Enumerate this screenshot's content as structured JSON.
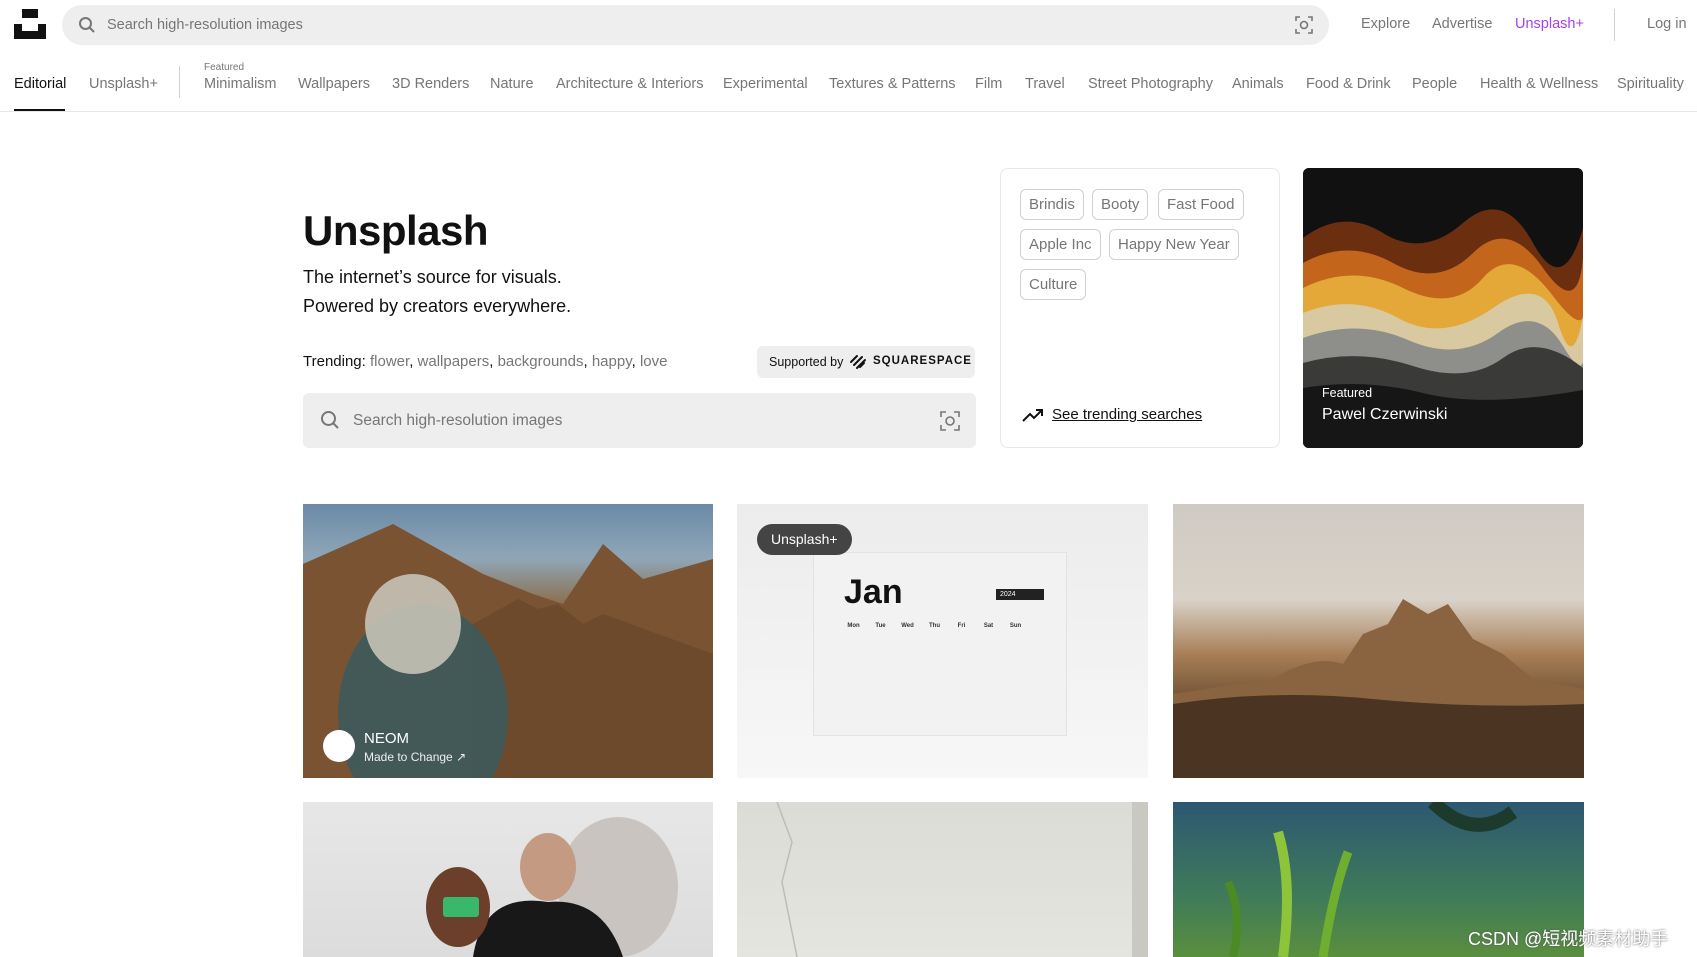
{
  "header": {
    "search_placeholder": "Search high-resolution images",
    "nav": [
      "Explore",
      "Advertise",
      "Unsplash+",
      "Log in"
    ]
  },
  "tabs": {
    "editorial": "Editorial",
    "unsplash_plus": "Unsplash+",
    "featured_label": "Featured",
    "topics": [
      "Minimalism",
      "Wallpapers",
      "3D Renders",
      "Nature",
      "Architecture & Interiors",
      "Experimental",
      "Textures & Patterns",
      "Film",
      "Travel",
      "Street Photography",
      "Animals",
      "Food & Drink",
      "People",
      "Health & Wellness",
      "Spirituality"
    ]
  },
  "hero": {
    "title": "Unsplash",
    "subtitle_1": "The internet’s source for visuals.",
    "subtitle_2": "Powered by creators everywhere.",
    "trending_label": "Trending",
    "trending": [
      "flower",
      "wallpapers",
      "backgrounds",
      "happy",
      "love"
    ],
    "supported_by": "Supported by",
    "sponsor": "SQUARESPACE",
    "search_placeholder": "Search high-resolution images"
  },
  "trending_card": {
    "chips": [
      "Brindis",
      "Booty",
      "Fast Food",
      "Apple Inc",
      "Happy New Year",
      "Culture"
    ],
    "see_trending": "See trending searches"
  },
  "featured": {
    "label": "Featured",
    "author": "Pawel Czerwinski"
  },
  "photos": {
    "p1_name": "NEOM",
    "p1_tagline": "Made to Change ↗",
    "p2_badge": "Unsplash+",
    "calendar": {
      "month": "Jan",
      "year": "2024",
      "weekdays": [
        "Mon",
        "Tue",
        "Wed",
        "Thu",
        "Fri",
        "Sat",
        "Sun"
      ]
    }
  },
  "watermark": "CSDN @短视频素材助手",
  "colors": {
    "accent_plus": "#a440f5",
    "muted": "#767676"
  }
}
